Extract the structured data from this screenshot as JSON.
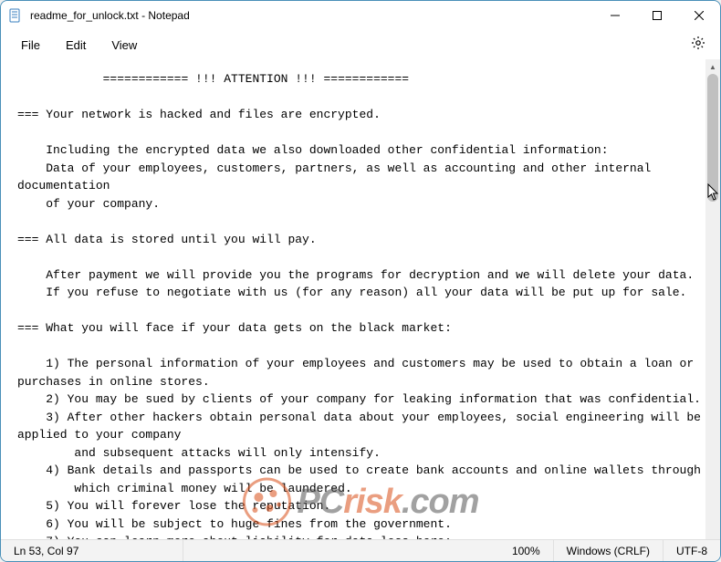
{
  "window": {
    "title": "readme_for_unlock.txt - Notepad"
  },
  "menu": {
    "file": "File",
    "edit": "Edit",
    "view": "View"
  },
  "doc": {
    "text": "            ============ !!! ATTENTION !!! ============\n\n=== Your network is hacked and files are encrypted.\n\n    Including the encrypted data we also downloaded other confidential information:\n    Data of your employees, customers, partners, as well as accounting and other internal documentation\n    of your company.\n\n=== All data is stored until you will pay.\n\n    After payment we will provide you the programs for decryption and we will delete your data.\n    If you refuse to negotiate with us (for any reason) all your data will be put up for sale.\n\n=== What you will face if your data gets on the black market:\n\n    1) The personal information of your employees and customers may be used to obtain a loan or purchases in online stores.\n    2) You may be sued by clients of your company for leaking information that was confidential.\n    3) After other hackers obtain personal data about your employees, social engineering will be applied to your company\n        and subsequent attacks will only intensify.\n    4) Bank details and passports can be used to create bank accounts and online wallets through\n        which criminal money will be laundered.\n    5) You will forever lose the reputation.\n    6) You will be subject to huge fines from the government.\n    7) You can learn more about liability for data loss here:"
  },
  "status": {
    "pos": "Ln 53, Col 97",
    "zoom": "100%",
    "eol": "Windows (CRLF)",
    "encoding": "UTF-8"
  },
  "watermark": {
    "pc": "PC",
    "risk": "risk",
    "com": ".com"
  }
}
